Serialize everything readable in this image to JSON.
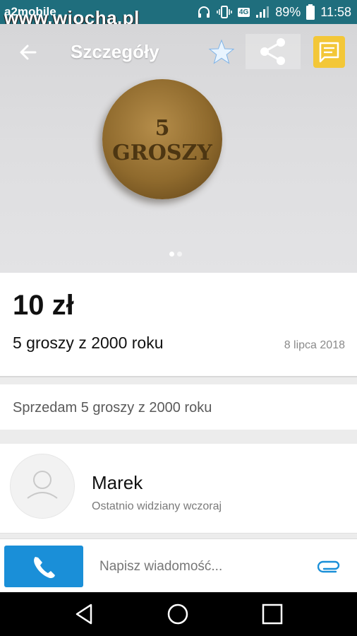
{
  "status_bar": {
    "carrier": "a2mobile",
    "watermark": "www.wiocha.pl",
    "network": "4G",
    "battery": "89%",
    "time": "11:58"
  },
  "toolbar": {
    "title": "Szczegóły",
    "back_icon": "arrow-left-icon",
    "favorite_icon": "star-icon",
    "share_icon": "share-icon",
    "message_icon": "chat-icon"
  },
  "gallery": {
    "coin_inscription": "5 GROSZY",
    "image_count": 2,
    "active_index": 0
  },
  "listing": {
    "price": "10 zł",
    "title": "5 groszy z 2000 roku",
    "date": "8 lipca 2018",
    "description": "Sprzedam 5 groszy z 2000 roku"
  },
  "seller": {
    "name": "Marek",
    "last_seen": "Ostatnio widziany wczoraj"
  },
  "message_bar": {
    "placeholder": "Napisz wiadomość...",
    "call_icon": "phone-icon",
    "attach_icon": "paperclip-icon"
  },
  "colors": {
    "status_bar": "#1f6e7d",
    "call_button": "#1a8fd8",
    "message_button": "#f3c738",
    "attach_icon": "#1a8fd8"
  }
}
